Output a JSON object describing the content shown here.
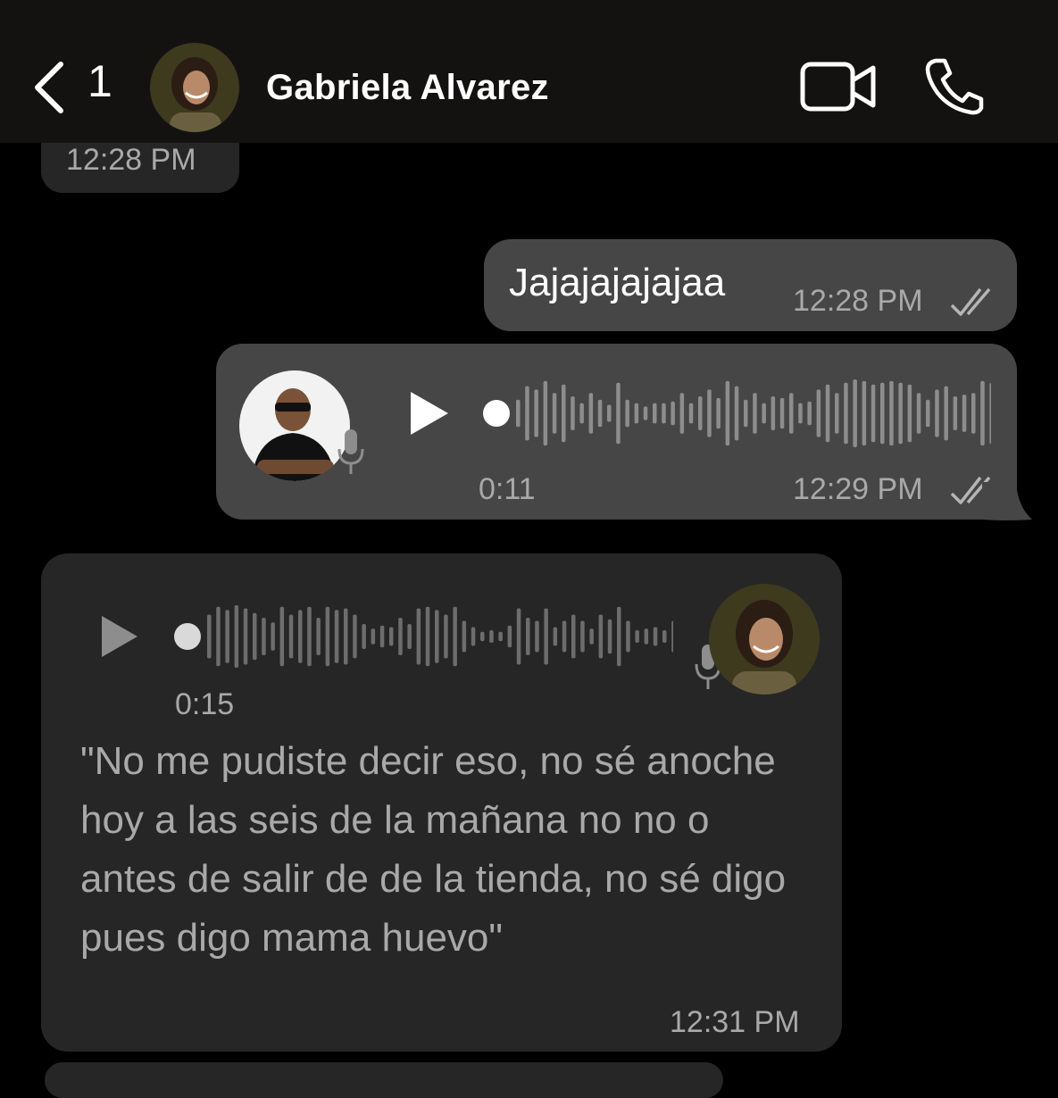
{
  "header": {
    "back_count": "1",
    "contact_name": "Gabriela Alvarez"
  },
  "messages": [
    {
      "id": "m0",
      "direction": "incoming",
      "time": "12:28 PM"
    },
    {
      "id": "m1",
      "direction": "outgoing",
      "text": "Jajajajajajaa",
      "time": "12:28 PM",
      "status": "read"
    },
    {
      "id": "m2",
      "direction": "outgoing",
      "type": "voice",
      "duration": "0:11",
      "time": "12:29 PM",
      "status": "read"
    },
    {
      "id": "m3",
      "direction": "incoming",
      "type": "voice",
      "duration": "0:15",
      "transcript": "\"No me pudiste decir eso, no sé anoche hoy a las seis de la mañana no no o antes de salir de de la tienda, no sé digo pues digo mama huevo\"",
      "time": "12:31 PM"
    }
  ],
  "colors": {
    "background": "#000000",
    "header_bg": "#141211",
    "incoming_bubble": "#262626",
    "outgoing_bubble": "#464646",
    "secondary_text": "#a9a9a9"
  },
  "icons": [
    "chevron-left-icon",
    "video-camera-icon",
    "phone-icon",
    "play-icon",
    "microphone-icon",
    "double-check-icon"
  ]
}
